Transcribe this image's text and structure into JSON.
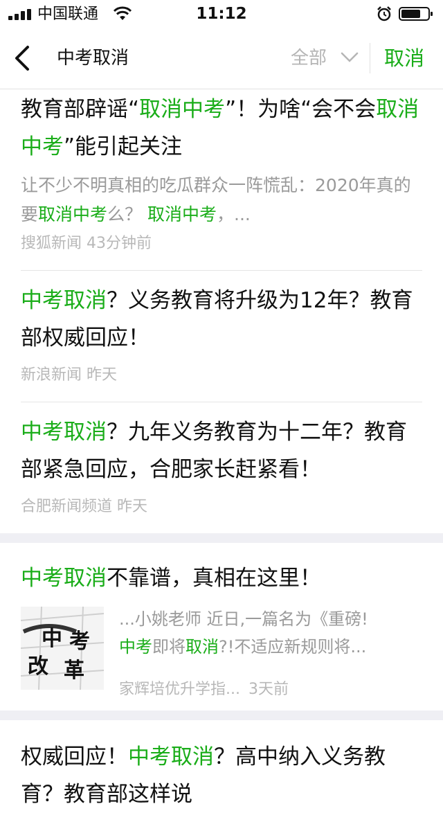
{
  "status_bar": {
    "carrier": "中国联通",
    "time": "11:12"
  },
  "nav": {
    "query": "中考取消",
    "filter_label": "全部",
    "cancel_label": "取消"
  },
  "results": [
    {
      "title_parts": [
        "教育部辟谣“",
        "取消中考",
        "”！为啥“会不会",
        "取消中考",
        "”能引起关注"
      ],
      "snippet_parts": [
        "让不少不明真相的吃瓜群众一阵慌乱：2020年真的要",
        "取消中考",
        "么？ ",
        "取消中考",
        "，..."
      ],
      "source": "搜狐新闻",
      "time": "43分钟前"
    },
    {
      "title_parts": [
        "中考取消",
        "？义务教育将升级为12年？教育部权威回应！"
      ],
      "source": "新浪新闻",
      "time": "昨天"
    },
    {
      "title_parts": [
        "中考取消",
        "？九年义务教育为十二年？教育部紧急回应，合肥家长赶紧看！"
      ],
      "source": "合肥新闻频道",
      "time": "昨天"
    },
    {
      "title_parts": [
        "中考取消",
        "不靠谱，真相在这里！"
      ],
      "snippet_line1": "...小姚老师 近日,一篇名为《重磅!",
      "snippet_parts": [
        "中考",
        "即将",
        "取消",
        "?!不适应新规则将..."
      ],
      "thumb_text": [
        "中",
        "考",
        "改",
        "革"
      ],
      "source": "家辉培优升学指...",
      "time": "3天前"
    },
    {
      "title_parts": [
        "权威回应！",
        "中考取消",
        "？高中纳入义务教育？教育部这样说"
      ]
    }
  ],
  "colors": {
    "accent": "#1aad19",
    "muted": "#9a9a9a",
    "band": "#efeff4"
  },
  "icons": [
    "signal-icon",
    "wifi-icon",
    "alarm-icon",
    "battery-icon",
    "back-arrow-icon",
    "chevron-down-icon"
  ]
}
